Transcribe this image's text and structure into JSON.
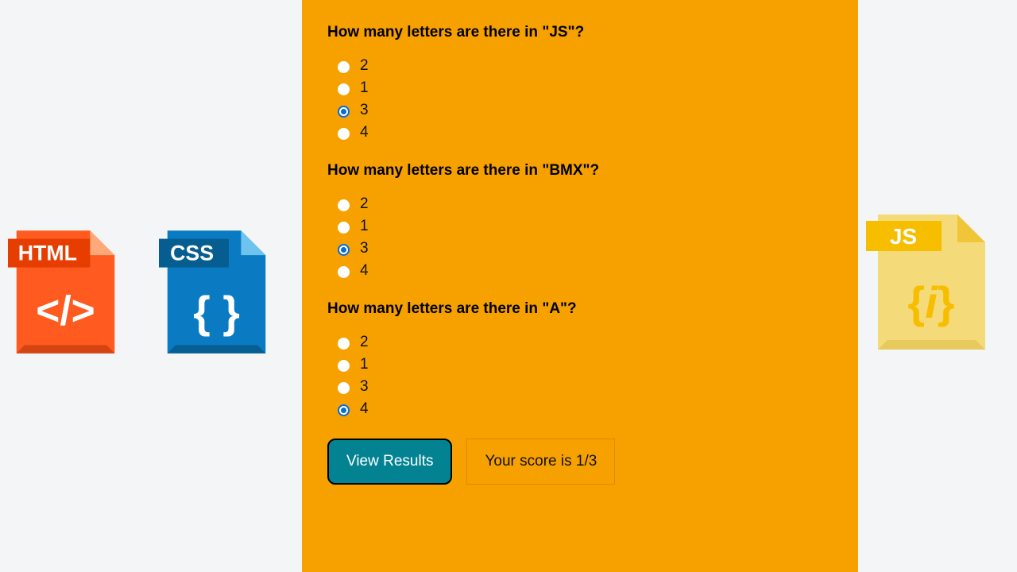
{
  "icons": {
    "html_label": "HTML",
    "css_label": "CSS",
    "js_label": "JS"
  },
  "quiz": {
    "questions": [
      {
        "prompt": "How many letters are there in \"JS\"?",
        "answers": [
          "2",
          "1",
          "3",
          "4"
        ],
        "selected_index": 2
      },
      {
        "prompt": "How many letters are there in \"BMX\"?",
        "answers": [
          "2",
          "1",
          "3",
          "4"
        ],
        "selected_index": 2
      },
      {
        "prompt": "How many letters are there in \"A\"?",
        "answers": [
          "2",
          "1",
          "3",
          "4"
        ],
        "selected_index": 3
      }
    ],
    "view_results_label": "View Results",
    "score_text": "Your score is 1/3"
  }
}
